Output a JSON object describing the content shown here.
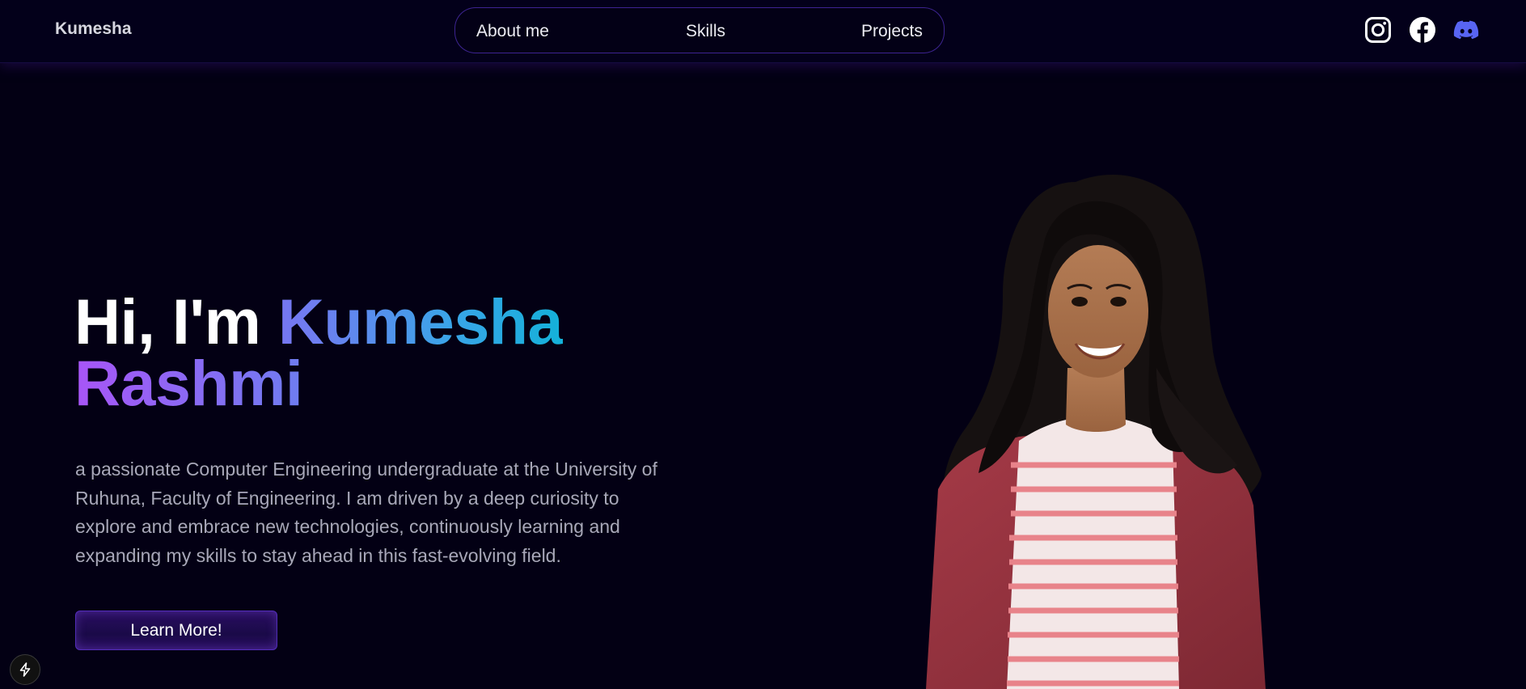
{
  "navbar": {
    "brand": "Kumesha",
    "links": [
      {
        "label": "About me"
      },
      {
        "label": "Skills"
      },
      {
        "label": "Projects"
      }
    ],
    "social": [
      {
        "icon": "instagram-icon",
        "color": "#ffffff"
      },
      {
        "icon": "facebook-icon",
        "color": "#ffffff"
      },
      {
        "icon": "discord-icon",
        "color": "#5865f2"
      }
    ]
  },
  "hero": {
    "greeting": "Hi, I'm",
    "first_name": "Kumesha",
    "last_name": "Rashmi",
    "description": "a passionate Computer Engineering undergraduate at the University of Ruhuna, Faculty of Engineering. I am driven by a deep curiosity to explore and embrace new technologies, continuously learning and expanding my skills to stay ahead in this fast-evolving field.",
    "cta_label": "Learn More!",
    "gradient_colors": [
      "#a855f7",
      "#06b6d4"
    ]
  },
  "floating_badge": {
    "icon": "bolt-icon"
  },
  "colors": {
    "background": "#030014",
    "accent": "#7042f8",
    "text_muted": "#a8a8b8"
  }
}
